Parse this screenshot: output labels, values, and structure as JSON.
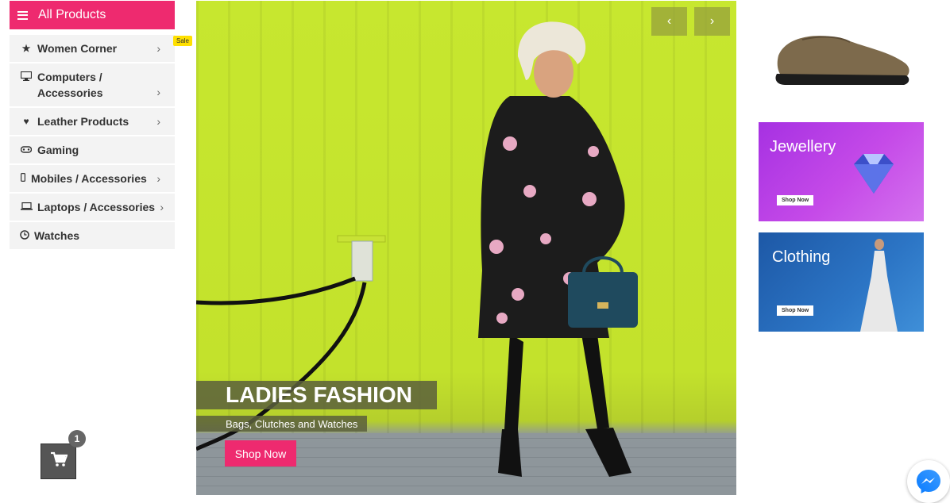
{
  "sidebar": {
    "header_label": "All Products",
    "items": [
      {
        "label": "Women Corner",
        "icon": "star-icon",
        "badge": "Sale"
      },
      {
        "label": "Computers / Accessories",
        "icon": "desktop-icon"
      },
      {
        "label": "Leather Products",
        "icon": "heart-icon"
      },
      {
        "label": "Gaming",
        "icon": "gamepad-icon"
      },
      {
        "label": "Mobiles / Accessories",
        "icon": "mobile-icon"
      },
      {
        "label": "Laptops / Accessories",
        "icon": "laptop-icon"
      },
      {
        "label": "Watches",
        "icon": "clock-icon"
      }
    ]
  },
  "cart": {
    "count": "1"
  },
  "hero": {
    "title": "LADIES FASHION",
    "subtitle": "Bags, Clutches and Watches",
    "cta": "Shop Now",
    "prev": "‹",
    "next": "›"
  },
  "side_banners": [
    {
      "title": "Jewellery",
      "cta": "Shop Now"
    },
    {
      "title": "Clothing",
      "cta": "Shop Now"
    }
  ],
  "colors": {
    "accent": "#ee2a6f",
    "hero_bg": "#c7e72f"
  }
}
